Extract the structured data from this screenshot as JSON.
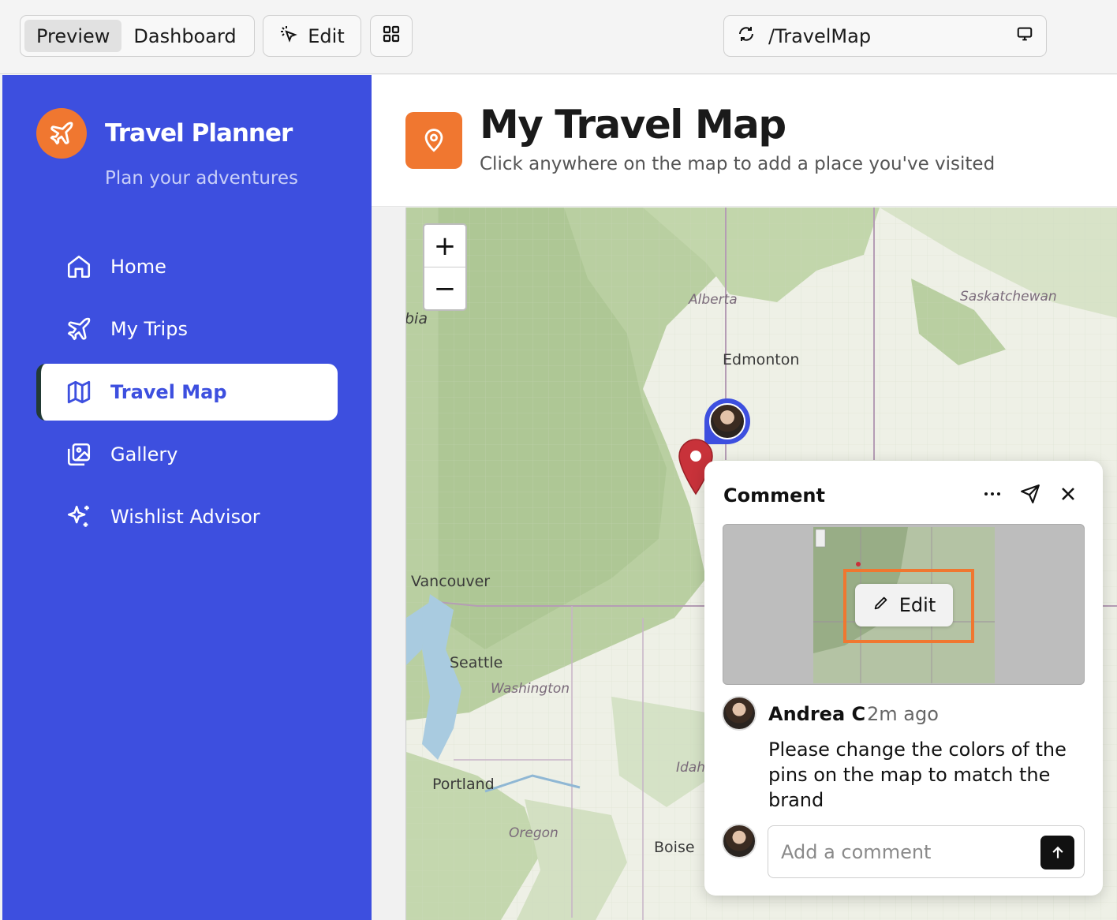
{
  "topbar": {
    "tabs": [
      {
        "label": "Preview",
        "active": true
      },
      {
        "label": "Dashboard",
        "active": false
      }
    ],
    "edit_label": "Edit",
    "url": "/TravelMap"
  },
  "sidebar": {
    "brand": "Travel Planner",
    "tagline": "Plan your adventures",
    "items": [
      {
        "label": "Home",
        "icon": "home-icon"
      },
      {
        "label": "My Trips",
        "icon": "plane-icon"
      },
      {
        "label": "Travel Map",
        "icon": "map-icon",
        "active": true
      },
      {
        "label": "Gallery",
        "icon": "gallery-icon"
      },
      {
        "label": "Wishlist Advisor",
        "icon": "sparkle-icon"
      }
    ]
  },
  "header": {
    "title": "My Travel Map",
    "subtitle": "Click anywhere on the map to add a place you've visited"
  },
  "map": {
    "zoom_in": "+",
    "zoom_out": "−",
    "labels": {
      "alberta": "Alberta",
      "saskatchewan": "Saskatchewan",
      "edmonton": "Edmonton",
      "vancouver": "Vancouver",
      "seattle": "Seattle",
      "washington": "Washington",
      "portland": "Portland",
      "oregon": "Oregon",
      "idaho": "Idah",
      "boise": "Boise",
      "bia": "bia"
    }
  },
  "comment": {
    "title": "Comment",
    "edit_chip": "Edit",
    "author": "Andrea C",
    "time": "2m ago",
    "body": "Please change the colors of the pins on the map to match the brand",
    "input_placeholder": "Add a comment"
  },
  "colors": {
    "brand_blue": "#3d4fdf",
    "accent_orange": "#f07730",
    "pin_red": "#c8323a"
  }
}
